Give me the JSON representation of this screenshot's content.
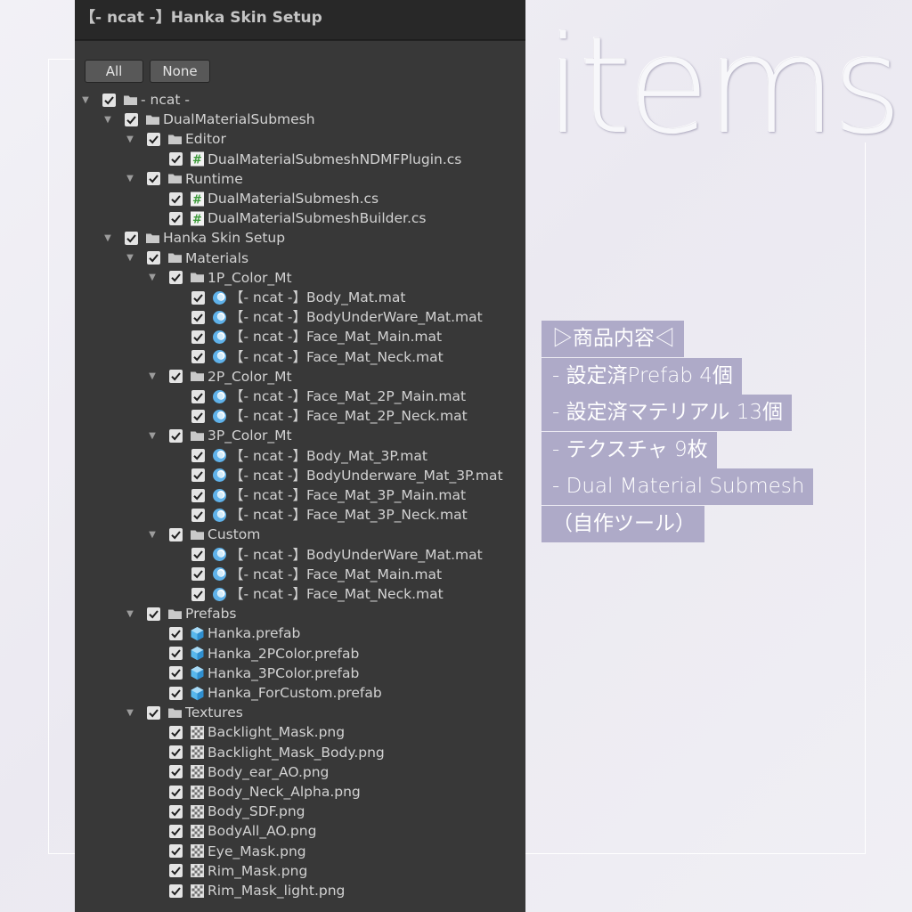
{
  "window": {
    "title": "【- ncat -】Hanka Skin Setup"
  },
  "toolbar": {
    "all_label": "All",
    "none_label": "None"
  },
  "tree": [
    {
      "label": "- ncat -",
      "depth": 0,
      "icon": "folder-icon",
      "expanded": true,
      "checked": true
    },
    {
      "label": "DualMaterialSubmesh",
      "depth": 1,
      "icon": "folder-icon",
      "expanded": true,
      "checked": true
    },
    {
      "label": "Editor",
      "depth": 2,
      "icon": "folder-icon",
      "expanded": true,
      "checked": true
    },
    {
      "label": "DualMaterialSubmeshNDMFPlugin.cs",
      "depth": 3,
      "icon": "csharp-script-icon",
      "checked": true
    },
    {
      "label": "Runtime",
      "depth": 2,
      "icon": "folder-icon",
      "expanded": true,
      "checked": true
    },
    {
      "label": "DualMaterialSubmesh.cs",
      "depth": 3,
      "icon": "csharp-script-icon",
      "checked": true
    },
    {
      "label": "DualMaterialSubmeshBuilder.cs",
      "depth": 3,
      "icon": "csharp-script-icon",
      "checked": true
    },
    {
      "label": "Hanka Skin Setup",
      "depth": 1,
      "icon": "folder-icon",
      "expanded": true,
      "checked": true
    },
    {
      "label": "Materials",
      "depth": 2,
      "icon": "folder-icon",
      "expanded": true,
      "checked": true
    },
    {
      "label": "1P_Color_Mt",
      "depth": 3,
      "icon": "folder-icon",
      "expanded": true,
      "checked": true
    },
    {
      "label": "【- ncat -】Body_Mat.mat",
      "depth": 4,
      "icon": "material-icon",
      "checked": true
    },
    {
      "label": "【- ncat -】BodyUnderWare_Mat.mat",
      "depth": 4,
      "icon": "material-icon",
      "checked": true
    },
    {
      "label": "【- ncat -】Face_Mat_Main.mat",
      "depth": 4,
      "icon": "material-icon",
      "checked": true
    },
    {
      "label": "【- ncat -】Face_Mat_Neck.mat",
      "depth": 4,
      "icon": "material-icon",
      "checked": true
    },
    {
      "label": "2P_Color_Mt",
      "depth": 3,
      "icon": "folder-icon",
      "expanded": true,
      "checked": true
    },
    {
      "label": "【- ncat -】Face_Mat_2P_Main.mat",
      "depth": 4,
      "icon": "material-icon",
      "checked": true
    },
    {
      "label": "【- ncat -】Face_Mat_2P_Neck.mat",
      "depth": 4,
      "icon": "material-icon",
      "checked": true
    },
    {
      "label": "3P_Color_Mt",
      "depth": 3,
      "icon": "folder-icon",
      "expanded": true,
      "checked": true
    },
    {
      "label": "【- ncat -】Body_Mat_3P.mat",
      "depth": 4,
      "icon": "material-icon",
      "checked": true
    },
    {
      "label": "【- ncat -】BodyUnderware_Mat_3P.mat",
      "depth": 4,
      "icon": "material-icon",
      "checked": true
    },
    {
      "label": "【- ncat -】Face_Mat_3P_Main.mat",
      "depth": 4,
      "icon": "material-icon",
      "checked": true
    },
    {
      "label": "【- ncat -】Face_Mat_3P_Neck.mat",
      "depth": 4,
      "icon": "material-icon",
      "checked": true
    },
    {
      "label": "Custom",
      "depth": 3,
      "icon": "folder-icon",
      "expanded": true,
      "checked": true
    },
    {
      "label": "【- ncat -】BodyUnderWare_Mat.mat",
      "depth": 4,
      "icon": "material-icon",
      "checked": true
    },
    {
      "label": "【- ncat -】Face_Mat_Main.mat",
      "depth": 4,
      "icon": "material-icon",
      "checked": true
    },
    {
      "label": "【- ncat -】Face_Mat_Neck.mat",
      "depth": 4,
      "icon": "material-icon",
      "checked": true
    },
    {
      "label": "Prefabs",
      "depth": 2,
      "icon": "folder-icon",
      "expanded": true,
      "checked": true
    },
    {
      "label": "Hanka.prefab",
      "depth": 3,
      "icon": "prefab-icon",
      "checked": true
    },
    {
      "label": "Hanka_2PColor.prefab",
      "depth": 3,
      "icon": "prefab-icon",
      "checked": true
    },
    {
      "label": "Hanka_3PColor.prefab",
      "depth": 3,
      "icon": "prefab-icon",
      "checked": true
    },
    {
      "label": "Hanka_ForCustom.prefab",
      "depth": 3,
      "icon": "prefab-icon",
      "checked": true
    },
    {
      "label": "Textures",
      "depth": 2,
      "icon": "folder-icon",
      "expanded": true,
      "checked": true
    },
    {
      "label": "Backlight_Mask.png",
      "depth": 3,
      "icon": "texture-icon",
      "checked": true
    },
    {
      "label": "Backlight_Mask_Body.png",
      "depth": 3,
      "icon": "texture-icon",
      "checked": true
    },
    {
      "label": "Body_ear_AO.png",
      "depth": 3,
      "icon": "texture-icon",
      "checked": true
    },
    {
      "label": "Body_Neck_Alpha.png",
      "depth": 3,
      "icon": "texture-icon",
      "checked": true
    },
    {
      "label": "Body_SDF.png",
      "depth": 3,
      "icon": "texture-icon",
      "checked": true
    },
    {
      "label": "BodyAll_AO.png",
      "depth": 3,
      "icon": "texture-icon",
      "checked": true
    },
    {
      "label": "Eye_Mask.png",
      "depth": 3,
      "icon": "texture-icon",
      "checked": true
    },
    {
      "label": "Rim_Mask.png",
      "depth": 3,
      "icon": "texture-icon",
      "checked": true
    },
    {
      "label": "Rim_Mask_light.png",
      "depth": 3,
      "icon": "texture-icon",
      "checked": true
    }
  ],
  "heading": "items",
  "info": {
    "lines": [
      "▷商品内容◁",
      " - 設定済Prefab 4個",
      " - 設定済マテリアル 13個",
      " - テクスチャ 9枚",
      " - Dual Material Submesh",
      "（自作ツール）"
    ],
    "highlight_color": "#aeaac8"
  },
  "colors": {
    "panel_bg": "#383838",
    "titlebar_bg": "#282828",
    "background": "#efeef4",
    "cs_icon_green": "#4fb14a",
    "material_blue": "#5fb2ea",
    "prefab_blue": "#58b7ec"
  }
}
